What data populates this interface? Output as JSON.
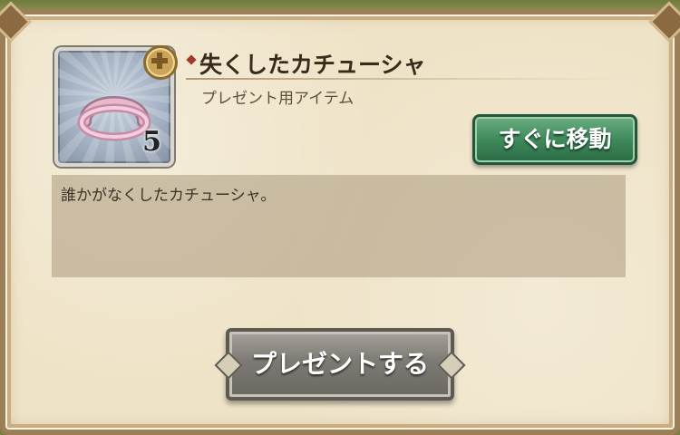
{
  "item": {
    "name": "失くしたカチューシャ",
    "type_label": "プレゼント用アイテム",
    "quantity": "5",
    "icon": "pink-headband-icon",
    "description": "誰かがなくしたカチューシャ。"
  },
  "actions": {
    "move_now_label": "すぐに移動",
    "present_label": "プレゼントする"
  }
}
